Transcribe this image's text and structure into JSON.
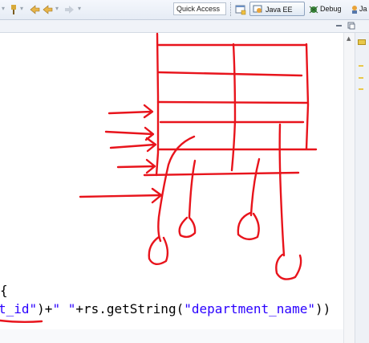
{
  "toolbar": {
    "quick_access": "Quick Access",
    "perspectives": [
      {
        "label": "Java EE",
        "icon": "java-ee-perspective-icon",
        "active": true
      },
      {
        "label": "Debug",
        "icon": "debug-perspective-icon",
        "active": false
      },
      {
        "label": "Ja",
        "icon": "java-perspective-icon",
        "active": false
      }
    ]
  },
  "editor": {
    "code_line_1": "{",
    "code_line_2": {
      "seg1": "t_id\"",
      "seg2": ")+",
      "seg3": "\" \"",
      "seg4": "+rs.getString(",
      "seg5": "\"department_name\"",
      "seg6": "))"
    },
    "colors": {
      "string": "#2a00ff",
      "ink": "#e8141c"
    }
  }
}
